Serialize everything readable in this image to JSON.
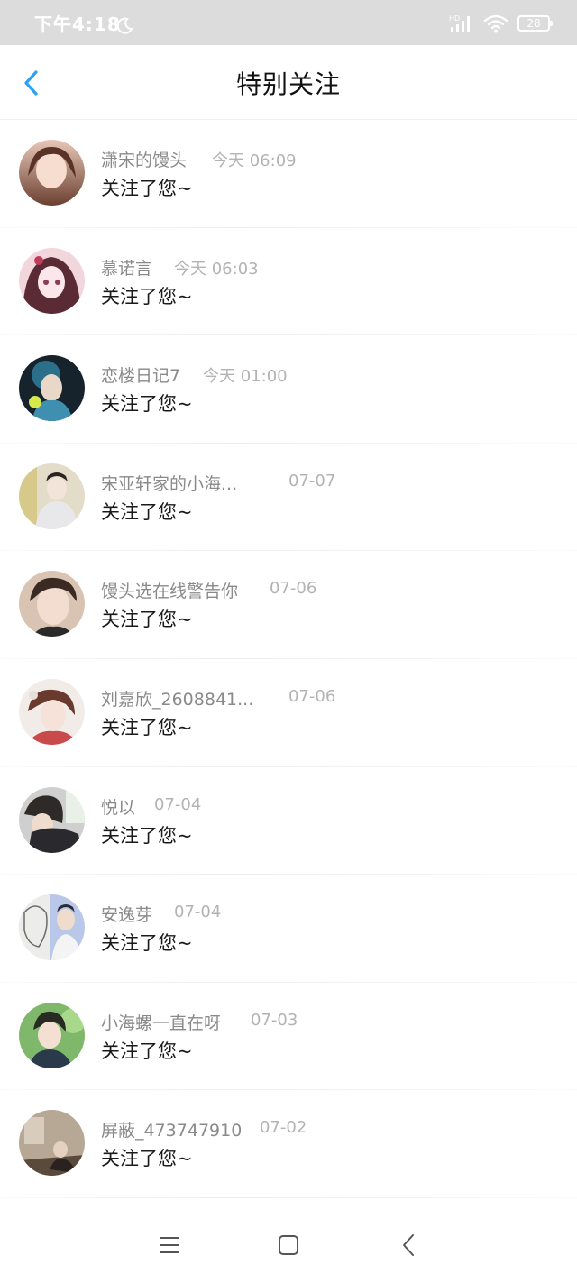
{
  "status_bar": {
    "time": "下午4:18",
    "network_label": "HD",
    "battery": "28",
    "icons": [
      "moon-icon",
      "signal-icon",
      "wifi-icon",
      "battery-icon"
    ]
  },
  "header": {
    "title": "特别关注",
    "back_icon": "chevron-left-icon",
    "accent_color": "#2aa2f0"
  },
  "list": {
    "items": [
      {
        "name": "潇宋的馒头",
        "time": "今天 06:09",
        "message": "关注了您~",
        "avatar_colors": [
          "#e8c7b8",
          "#6b4030"
        ]
      },
      {
        "name": "慕诺言",
        "time": "今天 06:03",
        "message": "关注了您~",
        "avatar_colors": [
          "#f2d6de",
          "#5b2b35"
        ]
      },
      {
        "name": "恋楼日记7",
        "time": "今天 01:00",
        "message": "关注了您~",
        "avatar_colors": [
          "#2b6f8a",
          "#16222c"
        ]
      },
      {
        "name": "宋亚轩家的小海...",
        "time": "07-07",
        "message": "关注了您~",
        "avatar_colors": [
          "#e2dcc8",
          "#8a8272"
        ]
      },
      {
        "name": "馒头选在线警告你",
        "time": "07-06",
        "message": "关注了您~",
        "avatar_colors": [
          "#d9c4b4",
          "#3a2a22"
        ]
      },
      {
        "name": "刘嘉欣_2608841...",
        "time": "07-06",
        "message": "关注了您~",
        "avatar_colors": [
          "#f1ece8",
          "#6a3a2e"
        ]
      },
      {
        "name": "悦以",
        "time": "07-04",
        "message": "关注了您~",
        "avatar_colors": [
          "#cfcfcf",
          "#2e2a28"
        ]
      },
      {
        "name": "安逸芽",
        "time": "07-04",
        "message": "关注了您~",
        "avatar_colors": [
          "#b9c8e8",
          "#3a3a4a"
        ]
      },
      {
        "name": "小海螺一直在呀",
        "time": "07-03",
        "message": "关注了您~",
        "avatar_colors": [
          "#7fb86a",
          "#2a3a24"
        ]
      },
      {
        "name": "屏蔽_473747910",
        "time": "07-02",
        "message": "关注了您~",
        "avatar_colors": [
          "#b7a896",
          "#3a2e26"
        ]
      }
    ]
  },
  "nav_bar": {
    "icons": [
      "menu-icon",
      "home-icon",
      "back-icon"
    ]
  }
}
